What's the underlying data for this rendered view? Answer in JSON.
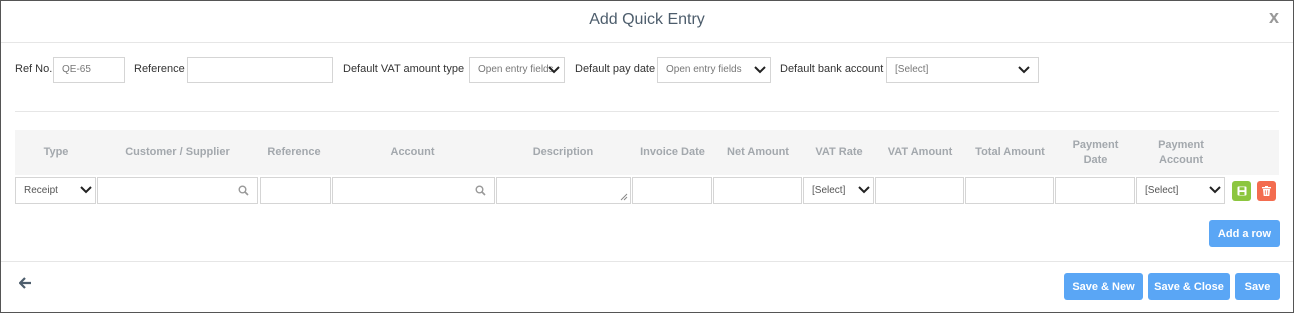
{
  "dialog": {
    "title": "Add Quick Entry",
    "close_glyph": "x"
  },
  "form": {
    "ref_no_label": "Ref No.",
    "ref_no_value": "QE-65",
    "reference_label": "Reference",
    "reference_value": "",
    "vat_type_label": "Default VAT amount type",
    "vat_type_value": "Open entry fields",
    "pay_date_label": "Default pay date",
    "pay_date_value": "Open entry fields",
    "bank_label": "Default bank account",
    "bank_value": "[Select]"
  },
  "grid": {
    "columns": [
      "Type",
      "Customer / Supplier",
      "Reference",
      "Account",
      "Description",
      "Invoice Date",
      "Net Amount",
      "VAT Rate",
      "VAT Amount",
      "Total Amount",
      "Payment Date",
      "Payment Account"
    ],
    "row": {
      "type": "Receipt",
      "customer": "",
      "reference": "",
      "account": "",
      "description": "",
      "invoice_date": "",
      "net_amount": "",
      "vat_rate": "[Select]",
      "vat_amount": "",
      "total_amount": "",
      "payment_date": "",
      "payment_account": "[Select]"
    }
  },
  "buttons": {
    "add_row": "Add a row",
    "save_new": "Save & New",
    "save_close": "Save & Close",
    "save": "Save"
  },
  "colors": {
    "primary": "#5aa6f5",
    "save_icon": "#8cc63f",
    "delete_icon": "#f36c4f",
    "title": "#4d5d6c"
  },
  "icons": {
    "close": "close-icon",
    "chevron": "chevron-down-icon",
    "search": "search-icon",
    "save_row": "floppy-icon",
    "delete_row": "trash-icon",
    "back": "arrow-left-icon"
  }
}
